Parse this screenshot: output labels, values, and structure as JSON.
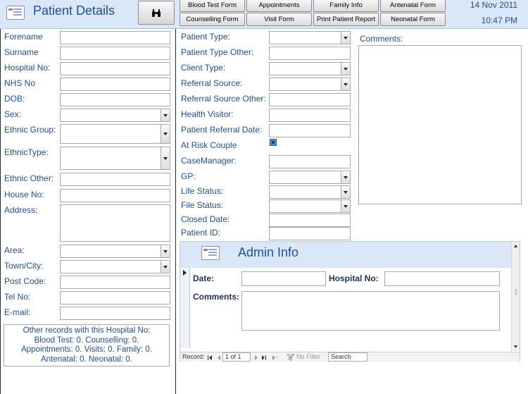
{
  "header": {
    "title": "Patient Details",
    "date": "14 Nov 2011",
    "time": "10:47 PM",
    "buttons": {
      "blood_test": "Blood Test Form",
      "appointments": "Appointments",
      "family_info": "Family Info",
      "antenatal": "Antenatal Form",
      "counselling": "Counselling Form",
      "visit": "Visit Form",
      "print_report": "Print Patient Report",
      "neonatal": "Neonatal Form"
    },
    "search_icon": "binoculars-icon"
  },
  "left_fields": {
    "forename": "Forename",
    "surname": "Surname",
    "hospital_no": "Hospital No:",
    "nhs_no": "NHS No",
    "dob": "DOB:",
    "sex": "Sex:",
    "ethnic_group": "Ethnic Group:",
    "ethnic_type": "EthnicType:",
    "ethnic_other": "Ethnic Other:",
    "house_no": "House No:",
    "address": "Address:",
    "area": "Area:",
    "town_city": "Town/City:",
    "post_code": "Post Code:",
    "tel_no": "Tel No:",
    "email": "E-mail:"
  },
  "other_records": {
    "line1": "Other records with this Hospital No:",
    "line2": "Blood Test: 0.  Counselling: 0.",
    "line3": "Appointments: 0.  Visits: 0.  Family: 0.",
    "line4": "Antenatal: 0.  Neonatal: 0."
  },
  "middle_fields": {
    "patient_type": "Patient Type:",
    "patient_type_other": "Patient Type Other:",
    "client_type": "Client Type:",
    "referral_source": "Referral Source:",
    "referral_source_other": "Referral Source Other:",
    "health_visitor": "Health Visitor:",
    "patient_referral_date": "Patient Referral Date:",
    "at_risk_couple": "At Risk Couple",
    "case_manager": "CaseManager:",
    "gp": "GP:",
    "life_status": "Life Status:",
    "file_status": "File Status:",
    "closed_date": "Closed Date:",
    "patient_id": "Patient ID:"
  },
  "comments": {
    "label": "Comments:"
  },
  "admin": {
    "title": "Admin Info",
    "date_label": "Date:",
    "hospital_no_label": "Hospital No:",
    "comments_label": "Comments:",
    "nav": {
      "record_label": "Record:",
      "position": "1 of 1",
      "filter": "No Filter",
      "search": "Search"
    }
  }
}
